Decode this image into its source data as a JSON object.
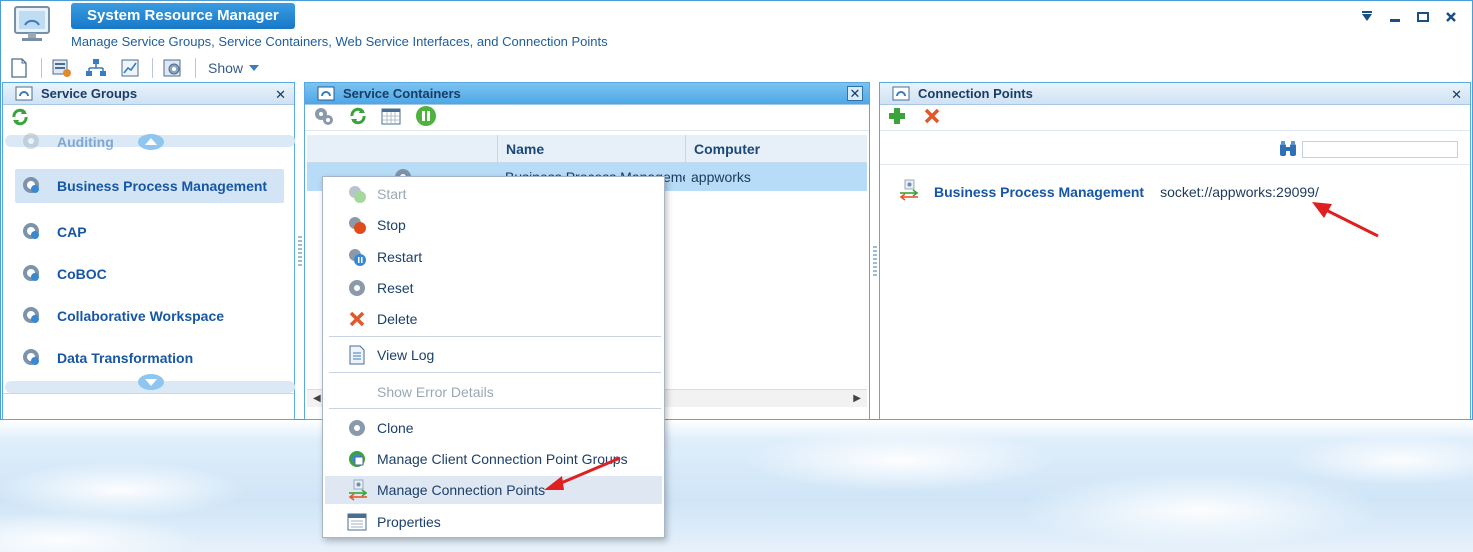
{
  "app": {
    "title": "System Resource Manager",
    "subtitle": "Manage Service Groups, Service Containers, Web Service Interfaces, and Connection Points",
    "show_label": "Show"
  },
  "panels": {
    "service_groups": {
      "title": "Service Groups",
      "items": [
        {
          "label": "Auditing"
        },
        {
          "label": "Business Process Management"
        },
        {
          "label": "CAP"
        },
        {
          "label": "CoBOC"
        },
        {
          "label": "Collaborative Workspace"
        },
        {
          "label": "Data Transformation"
        }
      ]
    },
    "service_containers": {
      "title": "Service Containers",
      "columns": [
        "Name",
        "Computer"
      ],
      "row": {
        "name": "Business Process Manageme",
        "computer": "appworks"
      }
    },
    "connection_points": {
      "title": "Connection Points",
      "row": {
        "name": "Business Process Management",
        "url": "socket://appworks:29099/"
      }
    }
  },
  "context_menu": {
    "items": [
      {
        "label": "Start",
        "icon": "start-icon",
        "enabled": false
      },
      {
        "label": "Stop",
        "icon": "stop-icon",
        "enabled": true
      },
      {
        "label": "Restart",
        "icon": "restart-icon",
        "enabled": true
      },
      {
        "label": "Reset",
        "icon": "reset-icon",
        "enabled": true
      },
      {
        "label": "Delete",
        "icon": "delete-icon",
        "enabled": true
      },
      {
        "label": "View Log",
        "icon": "log-icon",
        "enabled": true
      },
      {
        "label": "Show Error Details",
        "icon": "",
        "enabled": false
      },
      {
        "label": "Clone",
        "icon": "clone-icon",
        "enabled": true
      },
      {
        "label": "Manage Client Connection Point Groups",
        "icon": "client-groups-icon",
        "enabled": true
      },
      {
        "label": "Manage Connection Points",
        "icon": "connection-points-icon",
        "enabled": true,
        "highlighted": true
      },
      {
        "label": "Properties",
        "icon": "properties-icon",
        "enabled": true
      }
    ]
  },
  "colors": {
    "accent": "#1778c8",
    "link": "#1656a4",
    "annotation_arrow": "#e02020"
  }
}
